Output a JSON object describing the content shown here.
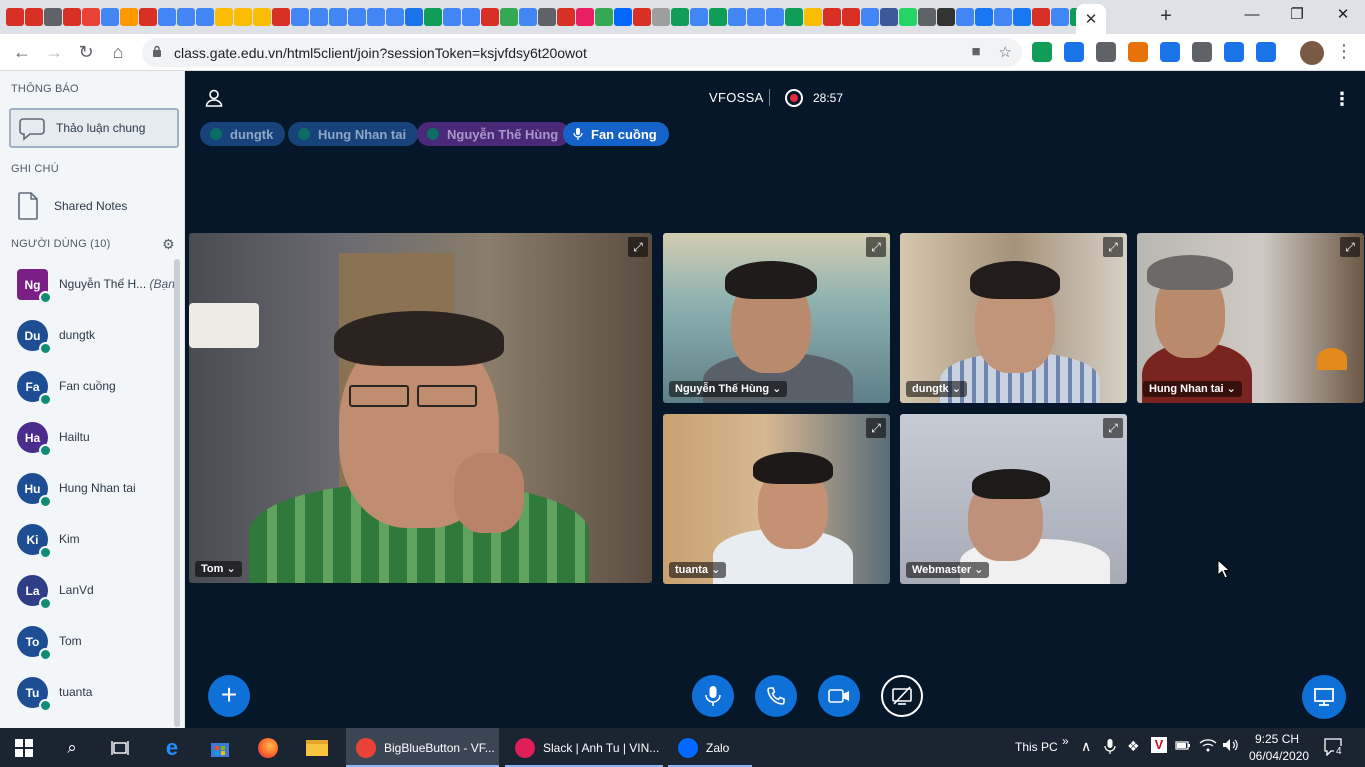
{
  "browser": {
    "url": "class.gate.edu.vn/html5client/join?sessionToken=ksjvfdsy6t20owot",
    "active_tab_close": "✕",
    "new_tab": "+",
    "win_minimize": "—",
    "win_restore": "❐",
    "win_close": "✕",
    "bookmark_favicons": [
      "#d93025",
      "#d93025",
      "#5f6368",
      "#d93025",
      "#ea4335",
      "#4285f4",
      "#ff9800",
      "#d93025",
      "#4285f4",
      "#4285f4",
      "#4285f4",
      "#fbbc04",
      "#fbbc04",
      "#fbbc04",
      "#d93025",
      "#4285f4",
      "#4285f4",
      "#4285f4",
      "#4285f4",
      "#4285f4",
      "#4285f4",
      "#1a73e8",
      "#0f9d58",
      "#4285f4",
      "#4285f4",
      "#d93025",
      "#34a853",
      "#4285f4",
      "#5f6368",
      "#d93025",
      "#e91e63",
      "#34a853",
      "#0068ff",
      "#d93025",
      "#9e9e9e",
      "#0f9d58",
      "#4285f4",
      "#0f9d58",
      "#4285f4",
      "#4285f4",
      "#4285f4",
      "#0f9d58",
      "#fbbc04",
      "#d93025",
      "#d93025",
      "#4285f4",
      "#3b5998",
      "#25d366",
      "#5f6368",
      "#333333",
      "#4285f4",
      "#1877f2",
      "#4285f4",
      "#1877f2",
      "#d93025",
      "#4285f4",
      "#0f9d58"
    ]
  },
  "sidebar": {
    "notifications_title": "THÔNG BÁO",
    "chat_label": "Thảo luận chung",
    "notes_title": "GHI CHÚ",
    "notes_label": "Shared Notes",
    "users_title": "NGƯỜI DÙNG (10)",
    "users": [
      {
        "initials": "Ng",
        "name": "Nguyễn Thế H...",
        "suffix": "(Bạn)",
        "color": "#7a1f86",
        "square": true
      },
      {
        "initials": "Du",
        "name": "dungtk",
        "suffix": "",
        "color": "#1d4e94",
        "square": false
      },
      {
        "initials": "Fa",
        "name": "Fan cuồng",
        "suffix": "",
        "color": "#1d4e94",
        "square": false
      },
      {
        "initials": "Ha",
        "name": "Hailtu",
        "suffix": "",
        "color": "#4a2c8c",
        "square": false
      },
      {
        "initials": "Hu",
        "name": "Hung Nhan tai",
        "suffix": "",
        "color": "#1d4e94",
        "square": false
      },
      {
        "initials": "Ki",
        "name": "Kim",
        "suffix": "",
        "color": "#1d4e94",
        "square": false
      },
      {
        "initials": "La",
        "name": "LanVd",
        "suffix": "",
        "color": "#2f3c86",
        "square": false
      },
      {
        "initials": "To",
        "name": "Tom",
        "suffix": "",
        "color": "#1d4e94",
        "square": false
      },
      {
        "initials": "Tu",
        "name": "tuanta",
        "suffix": "",
        "color": "#1d4e94",
        "square": false
      }
    ]
  },
  "header": {
    "title": "VFOSSA",
    "recording_time": "28:57",
    "kebab": "⋮"
  },
  "talkers": [
    {
      "name": "dungtk",
      "bg": "#17437a",
      "fg": "#8fa6c4",
      "dot": "#0b6d63",
      "mic": false
    },
    {
      "name": "Hung Nhan tai",
      "bg": "#17437a",
      "fg": "#8fa6c4",
      "dot": "#0b6d63",
      "mic": false
    },
    {
      "name": "Nguyễn Thế Hùng",
      "bg": "#4a2a78",
      "fg": "#a897c8",
      "dot": "#0b6d63",
      "mic": false
    },
    {
      "name": "Fan cuồng",
      "bg": "#1563c9",
      "fg": "#ffffff",
      "dot": "",
      "mic": true
    }
  ],
  "videos": [
    {
      "name": "Tom",
      "caret": "⌄"
    },
    {
      "name": "Nguyễn Thế Hùng",
      "caret": "⌄"
    },
    {
      "name": "dungtk",
      "caret": "⌄"
    },
    {
      "name": "Hung Nhan tai",
      "caret": "⌄"
    },
    {
      "name": "tuanta",
      "caret": "⌄"
    },
    {
      "name": "Webmaster",
      "caret": "⌄"
    }
  ],
  "controls": {
    "plus": "+",
    "expand_glyph": "⤢"
  },
  "taskbar": {
    "apps": [
      {
        "label": "BigBlueButton - VF...",
        "active": true,
        "color": "#ea4335"
      },
      {
        "label": "Slack | Anh Tu | VIN...",
        "active": false,
        "color": "#e01e5a"
      },
      {
        "label": "Zalo",
        "active": false,
        "color": "#0068ff"
      }
    ],
    "this_pc": "This PC",
    "chevrons": "»",
    "time": "9:25 CH",
    "date": "06/04/2020",
    "notifications": "4"
  },
  "colors": {
    "main_bg": "#06172a",
    "accent": "#0f70d7",
    "sidebar_bg": "#f3f6f9"
  }
}
